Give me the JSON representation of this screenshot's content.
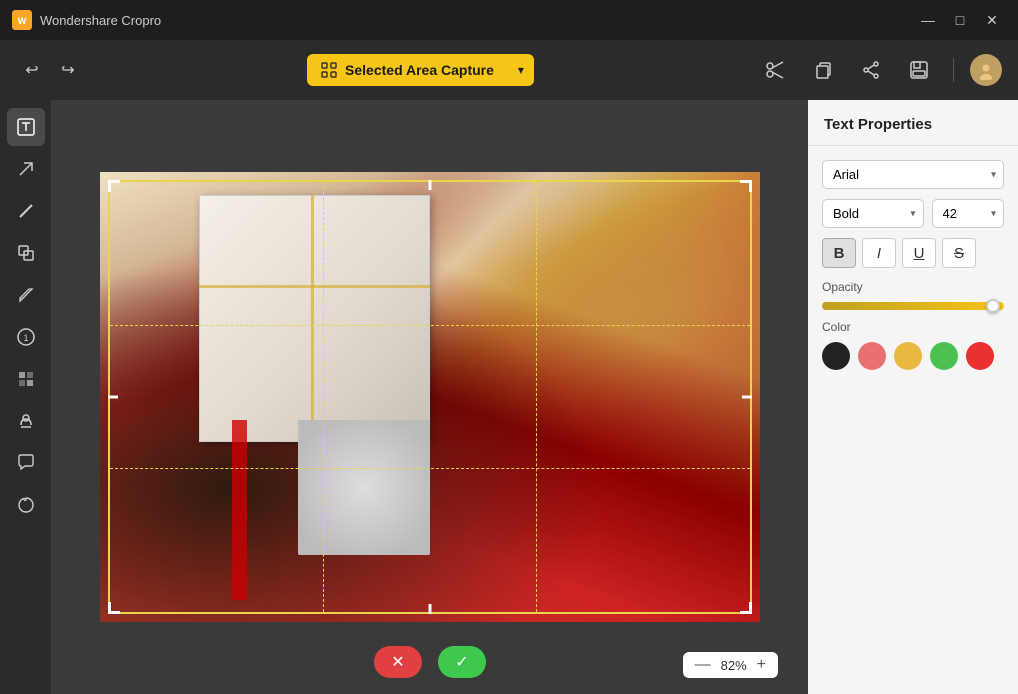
{
  "app": {
    "name": "Wondershare Cropro",
    "logo_char": "W"
  },
  "titlebar": {
    "minimize": "—",
    "maximize": "□",
    "close": "✕"
  },
  "toolbar": {
    "undo_label": "↩",
    "redo_label": "↪",
    "capture_label": "Selected Area Capture",
    "capture_arrow": "▾",
    "cut_label": "✂",
    "copy_label": "⧉",
    "share_label": "⬆",
    "save_label": "💾"
  },
  "left_tools": [
    {
      "name": "text-tool",
      "icon": "✎",
      "active": true
    },
    {
      "name": "arrow-tool",
      "icon": "↗"
    },
    {
      "name": "line-tool",
      "icon": "╱"
    },
    {
      "name": "copy-area-tool",
      "icon": "⧉"
    },
    {
      "name": "pen-tool",
      "icon": "✏"
    },
    {
      "name": "numbered-tool",
      "icon": "①"
    },
    {
      "name": "mosaic-tool",
      "icon": "▦"
    },
    {
      "name": "stamp-tool",
      "icon": "🖊"
    },
    {
      "name": "speech-bubble-tool",
      "icon": "💬"
    },
    {
      "name": "lasso-tool",
      "icon": "⊙"
    }
  ],
  "canvas": {
    "zoom_percent": "82%",
    "zoom_minus": "—",
    "zoom_plus": "+"
  },
  "right_panel": {
    "title": "Text Properties",
    "font_family": "Arial",
    "font_weight": "Bold",
    "font_size": "42",
    "format_buttons": [
      {
        "name": "bold",
        "label": "B",
        "active": true
      },
      {
        "name": "italic",
        "label": "I",
        "active": false
      },
      {
        "name": "underline",
        "label": "U",
        "active": false
      },
      {
        "name": "strikethrough",
        "label": "S",
        "active": false
      }
    ],
    "opacity_label": "Opacity",
    "color_label": "Color",
    "colors": [
      {
        "name": "black",
        "hex": "#222222"
      },
      {
        "name": "pink",
        "hex": "#e87070"
      },
      {
        "name": "yellow",
        "hex": "#e8b840"
      },
      {
        "name": "green",
        "hex": "#4ac050"
      },
      {
        "name": "red",
        "hex": "#e83030"
      }
    ]
  },
  "bottom_controls": {
    "cancel_icon": "✕",
    "confirm_icon": "✓"
  }
}
